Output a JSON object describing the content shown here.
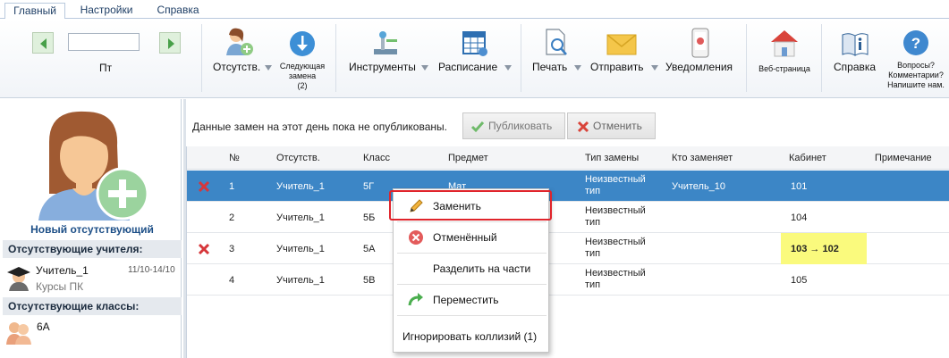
{
  "tabs": [
    "Главный",
    "Настройки",
    "Справка"
  ],
  "ribbon": {
    "day_label": "Пт",
    "absent_label": "Отсутств.",
    "next_sub_line1": "Следующая",
    "next_sub_line2": "замена",
    "next_sub_line3": "(2)",
    "tools_label": "Инструменты",
    "schedule_label": "Расписание",
    "print_label": "Печать",
    "send_label": "Отправить",
    "notify_label": "Уведомления",
    "web_label": "Веб-страница",
    "help_label": "Справка",
    "questions_line1": "Вопросы?",
    "questions_line2": "Комментарии?",
    "questions_line3": "Напишите нам."
  },
  "left": {
    "new_absent": "Новый отсутствующий",
    "absent_teachers_header": "Отсутствующие учителя:",
    "teacher_name": "Учитель_1",
    "teacher_dates": "11/10-14/10",
    "teacher_reason": "Курсы ПК",
    "absent_classes_header": "Отсутствующие классы:",
    "class_name": "6А"
  },
  "notice": "Данные замен на этот день пока не опубликованы.",
  "publish_label": "Публиковать",
  "cancel_label": "Отменить",
  "grid": {
    "headers": [
      "№",
      "Отсутств.",
      "Класс",
      "Предмет",
      "Тип замены",
      "Кто заменяет",
      "Кабинет",
      "Примечание"
    ],
    "rows": [
      {
        "num": "1",
        "absent": "Учитель_1",
        "class": "5Г",
        "subject": "Мат",
        "type1": "Неизвестный",
        "type2": "тип",
        "sub": "Учитель_10",
        "room": "101"
      },
      {
        "num": "2",
        "absent": "Учитель_1",
        "class": "5Б",
        "subject": "",
        "type1": "Неизвестный",
        "type2": "тип",
        "sub": "",
        "room": "104"
      },
      {
        "num": "3",
        "absent": "Учитель_1",
        "class": "5А",
        "subject": "",
        "type1": "Неизвестный",
        "type2": "тип",
        "sub": "",
        "room": "103 → 102"
      },
      {
        "num": "4",
        "absent": "Учитель_1",
        "class": "5В",
        "subject": "",
        "type1": "Неизвестный",
        "type2": "тип",
        "sub": "",
        "room": "105"
      }
    ]
  },
  "menu": {
    "replace": "Заменить",
    "cancelled": "Отменённый",
    "split": "Разделить на части",
    "move": "Переместить",
    "ignore": "Игнорировать коллизий (1)"
  },
  "icons": [
    "nav-left-icon",
    "nav-right-icon",
    "add-absent-icon",
    "next-sub-icon",
    "tools-icon",
    "schedule-icon",
    "print-icon",
    "send-icon",
    "notify-icon",
    "web-icon",
    "help-icon",
    "questions-icon",
    "delete-icon",
    "check-icon",
    "pencil-icon",
    "cancel-icon",
    "move-arrow-icon"
  ],
  "colors": {
    "selected_row": "#3c86c6",
    "highlight": "#fafa7d",
    "menu_outline": "#e0242b"
  }
}
